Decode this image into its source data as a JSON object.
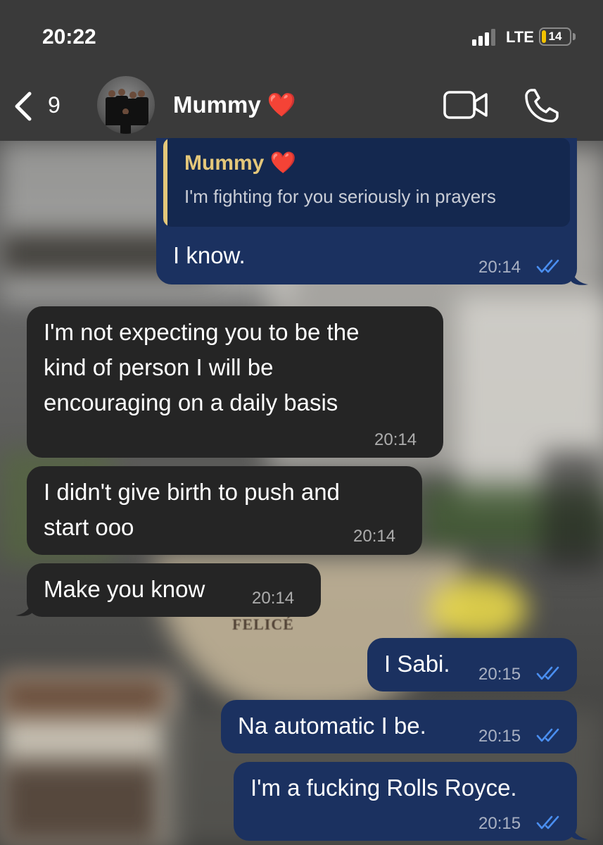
{
  "status_bar": {
    "time": "20:22",
    "network": "LTE",
    "battery": "14"
  },
  "header": {
    "back_count": "9",
    "contact_name": "Mummy ❤️"
  },
  "background": {
    "cafe_sign": "FELICÉ"
  },
  "messages": [
    {
      "direction": "outgoing",
      "quote": {
        "author": "Mummy ❤️",
        "text": "I'm fighting for you seriously in prayers"
      },
      "lines": [
        "I know."
      ],
      "time": "20:14",
      "read": true
    },
    {
      "direction": "incoming",
      "lines": [
        "I'm not expecting you to be the",
        "kind of person I will be",
        "encouraging on a daily basis"
      ],
      "time": "20:14"
    },
    {
      "direction": "incoming",
      "lines": [
        "I didn't give birth to push and",
        "start ooo"
      ],
      "time": "20:14"
    },
    {
      "direction": "incoming",
      "lines": [
        "Make you know"
      ],
      "time": "20:14"
    },
    {
      "direction": "outgoing",
      "lines": [
        "I Sabi."
      ],
      "time": "20:15",
      "read": true
    },
    {
      "direction": "outgoing",
      "lines": [
        "Na automatic I be."
      ],
      "time": "20:15",
      "read": true
    },
    {
      "direction": "outgoing",
      "lines": [
        "I'm a fucking Rolls Royce."
      ],
      "time": "20:15",
      "read": true
    }
  ],
  "colors": {
    "outgoing_bubble": "#1b3160",
    "incoming_bubble": "#252525",
    "read_ticks": "#4a8ef0",
    "quote_author": "#e4c77a"
  },
  "icons": [
    "back-chevron-icon",
    "video-camera-icon",
    "phone-icon",
    "double-check-icon"
  ]
}
